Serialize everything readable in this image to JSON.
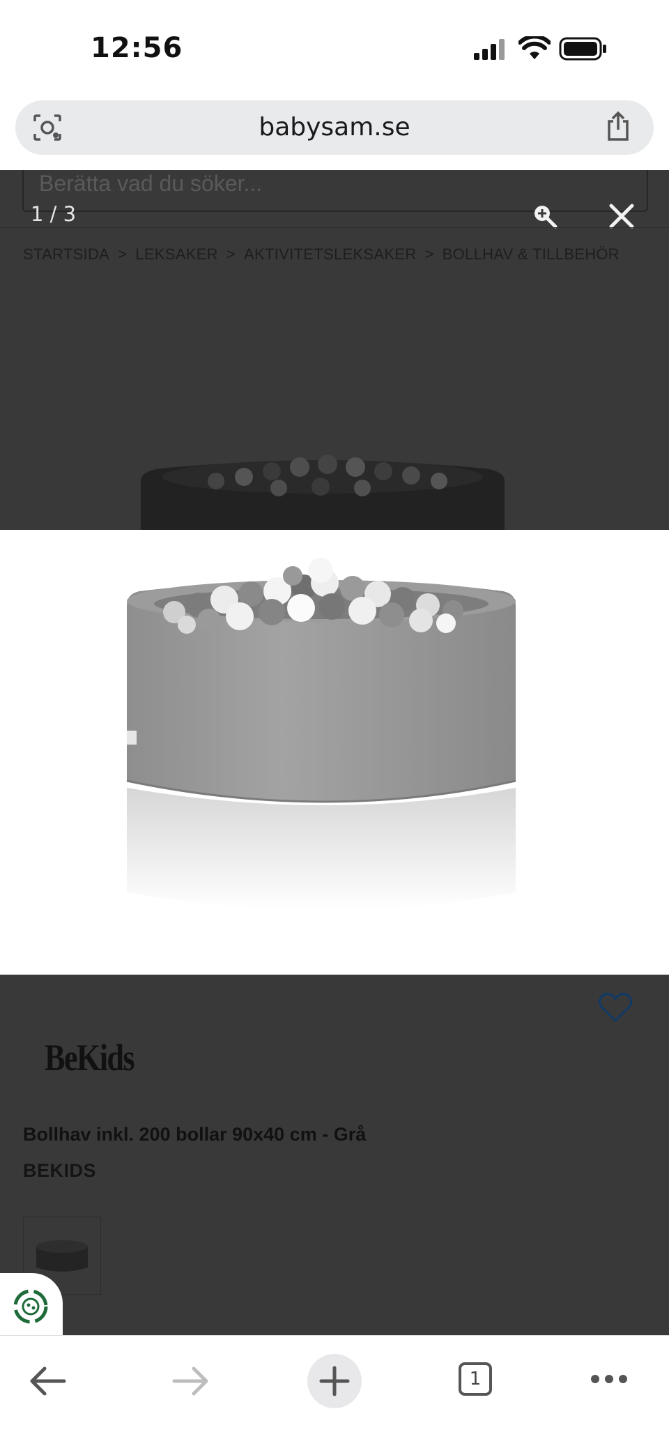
{
  "status_bar": {
    "time": "12:56"
  },
  "browser": {
    "url": "babysam.se",
    "tab_count": "1"
  },
  "search": {
    "placeholder": "Berätta vad du söker..."
  },
  "gallery": {
    "counter": "1 / 3"
  },
  "breadcrumb": [
    "STARTSIDA",
    "LEKSAKER",
    "AKTIVITETSLEKSAKER",
    "BOLLHAV & TILLBEHÖR"
  ],
  "breadcrumb_separator": ">",
  "product": {
    "logo_text": "BeKids",
    "title": "Bollhav inkl. 200 bollar 90x40 cm - Grå",
    "brand": "BEKIDS"
  },
  "colors": {
    "overlay": "#393939",
    "heart": "#0f3a66",
    "badge_green": "#1f6b3a"
  },
  "icons": [
    "screenshot-lens-icon",
    "share-icon",
    "zoom-in-icon",
    "close-icon",
    "heart-icon",
    "back-arrow-icon",
    "forward-arrow-icon",
    "new-tab-plus-icon",
    "tabs-icon",
    "more-icon"
  ]
}
